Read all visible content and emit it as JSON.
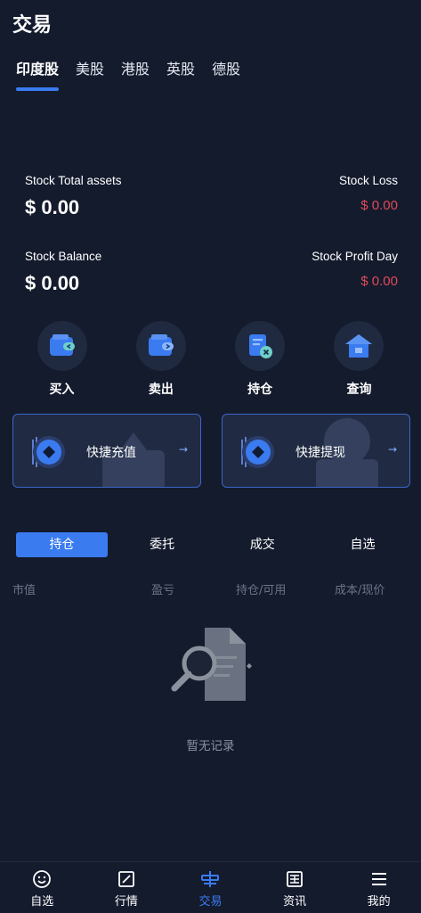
{
  "page": {
    "title": "交易"
  },
  "market_tabs": [
    {
      "label": "印度股",
      "active": true
    },
    {
      "label": "美股",
      "active": false
    },
    {
      "label": "港股",
      "active": false
    },
    {
      "label": "英股",
      "active": false
    },
    {
      "label": "德股",
      "active": false
    }
  ],
  "stats": {
    "total_assets_label": "Stock Total assets",
    "total_assets_value": "$ 0.00",
    "loss_label": "Stock Loss",
    "loss_value": "$ 0.00",
    "balance_label": "Stock Balance",
    "balance_value": "$ 0.00",
    "profit_day_label": "Stock Profit Day",
    "profit_day_value": "$ 0.00"
  },
  "actions": [
    {
      "label": "买入",
      "icon": "wallet-in-icon"
    },
    {
      "label": "卖出",
      "icon": "wallet-out-icon"
    },
    {
      "label": "持仓",
      "icon": "position-doc-icon"
    },
    {
      "label": "查询",
      "icon": "home-query-icon"
    }
  ],
  "quick": {
    "deposit_label": "快捷充值",
    "withdraw_label": "快捷提现",
    "arrow": "→"
  },
  "sub_tabs": [
    {
      "label": "持仓",
      "active": true
    },
    {
      "label": "委托",
      "active": false
    },
    {
      "label": "成交",
      "active": false
    },
    {
      "label": "自选",
      "active": false
    }
  ],
  "columns": [
    "市值",
    "盈亏",
    "持仓/可用",
    "成本/现价"
  ],
  "empty": {
    "text": "暂无记录"
  },
  "bottom_nav": [
    {
      "label": "自选",
      "icon": "smile-icon",
      "active": false
    },
    {
      "label": "行情",
      "icon": "chart-icon",
      "active": false
    },
    {
      "label": "交易",
      "icon": "trade-icon",
      "active": true
    },
    {
      "label": "资讯",
      "icon": "news-icon",
      "active": false
    },
    {
      "label": "我的",
      "icon": "menu-icon",
      "active": false
    }
  ],
  "colors": {
    "background": "#141b2d",
    "accent": "#3a7bf0",
    "loss_red": "#e04a5a"
  }
}
